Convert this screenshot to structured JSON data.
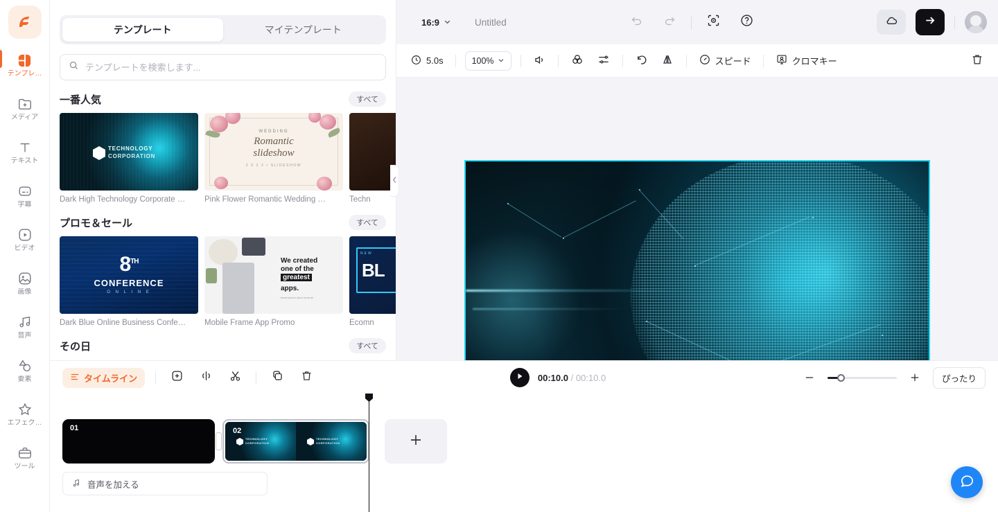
{
  "sidebar": {
    "logo": "logo-f",
    "items": [
      {
        "label": "テンプレ…",
        "icon": "template-icon",
        "active": true
      },
      {
        "label": "メディア",
        "icon": "media-add-icon",
        "active": false
      },
      {
        "label": "テキスト",
        "icon": "text-icon",
        "active": false
      },
      {
        "label": "字幕",
        "icon": "subtitle-icon",
        "active": false
      },
      {
        "label": "ビデオ",
        "icon": "video-icon",
        "active": false
      },
      {
        "label": "画像",
        "icon": "image-icon",
        "active": false
      },
      {
        "label": "音声",
        "icon": "audio-icon",
        "active": false
      },
      {
        "label": "要素",
        "icon": "elements-icon",
        "active": false
      },
      {
        "label": "エフェク…",
        "icon": "effects-icon",
        "active": false
      },
      {
        "label": "ツール",
        "icon": "tools-icon",
        "active": false
      }
    ]
  },
  "panel": {
    "tabs": [
      {
        "label": "テンプレート",
        "active": true
      },
      {
        "label": "マイテンプレート",
        "active": false
      }
    ],
    "search": {
      "placeholder": "テンプレートを検索します...",
      "value": "",
      "icon": "search-icon"
    },
    "sections": [
      {
        "title": "一番人気",
        "see_all": "すべて",
        "cards": [
          {
            "caption": "Dark High Technology Corporate …",
            "art": "tech",
            "line1": "TECHNOLOGY",
            "line2": "CORPORATION"
          },
          {
            "caption": "Pink Flower Romantic Wedding …",
            "art": "wedding",
            "line1": "WEDDING",
            "line2": "Romantic",
            "line3": "slideshow",
            "line4": "2 0 2 2 • SLIDESHOW"
          },
          {
            "caption": "Techn",
            "art": "dark",
            "line1": "",
            "line2": ""
          }
        ]
      },
      {
        "title": "プロモ＆セール",
        "see_all": "すべて",
        "cards": [
          {
            "caption": "Dark Blue Online Business Confe…",
            "art": "conference",
            "line1": "8",
            "line1_sup": "TH",
            "line2": "CONFERENCE",
            "line3": "O N L I N E"
          },
          {
            "caption": "Mobile Frame App Promo",
            "art": "app",
            "line1": "We created",
            "line2": "one of the",
            "line3": "greatest",
            "line4": "apps.",
            "line5": "lorem ipsum dolor sit amet"
          },
          {
            "caption": "Ecomn",
            "art": "ecom",
            "line1": "BL",
            "line2": "NEW"
          }
        ]
      },
      {
        "title": "その日",
        "see_all": "すべて",
        "cards": []
      }
    ],
    "collapse_icon": "chevron-left-icon"
  },
  "topbar": {
    "ratio": "16:9",
    "ratio_caret": "chevron-down-icon",
    "doc_title": "Untitled",
    "undo_icon": "undo-icon",
    "redo_icon": "redo-icon",
    "focus_icon": "focus-target-icon",
    "help_icon": "help-circle-icon",
    "cloud_icon": "cloud-icon",
    "export_icon": "arrow-right-icon",
    "avatar": "user-avatar"
  },
  "subbar": {
    "duration": "5.0s",
    "duration_icon": "clock-icon",
    "zoom_level": "100%",
    "zoom_caret": "chevron-down-icon",
    "volume_icon": "volume-icon",
    "color_icon": "color-circles-icon",
    "adjust_icon": "sliders-icon",
    "rotate_icon": "rotate-left-icon",
    "flip_icon": "flip-horizontal-icon",
    "speed_label": "スピード",
    "speed_icon": "speedometer-icon",
    "chroma_label": "クロマキー",
    "chroma_icon": "chroma-key-icon",
    "delete_icon": "trash-icon"
  },
  "preview": {
    "border_color": "#21d6ef",
    "description": "dark teal wireframe globe with network mesh"
  },
  "timeline": {
    "title": "タイムライン",
    "title_icon": "timeline-icon",
    "tools": [
      {
        "name": "add-icon"
      },
      {
        "name": "split-icon"
      },
      {
        "name": "cut-icon"
      },
      {
        "name": "duplicate-icon"
      },
      {
        "name": "trash-icon"
      }
    ],
    "play_icon": "play-icon",
    "current_time": "00:10.0",
    "total_time": "00:10.0",
    "time_separator": "/",
    "zoom_out_icon": "minus-icon",
    "zoom_in_icon": "plus-icon",
    "fit_label": "ぴったり",
    "clips": [
      {
        "number": "01",
        "selected": false,
        "art": "black"
      },
      {
        "number": "02",
        "selected": true,
        "art": "tech",
        "cell_line1": "TECHNOLOGY",
        "cell_line2": "CORPORATION"
      }
    ],
    "add_clip_icon": "plus-icon",
    "audio_label": "音声を加える",
    "audio_icon": "music-note-icon"
  },
  "chat": {
    "icon": "chat-bubble-icon",
    "color": "#1f86f7"
  }
}
